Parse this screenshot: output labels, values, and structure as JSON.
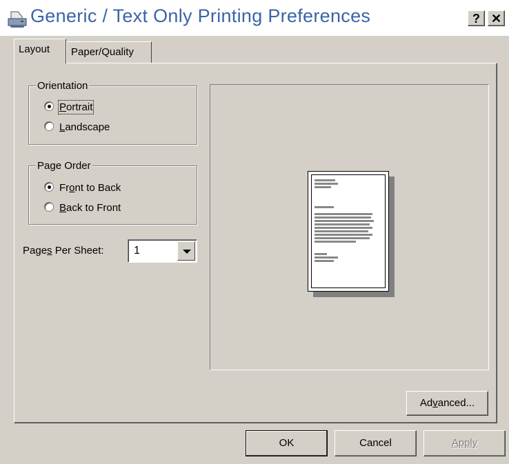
{
  "window": {
    "title": "Generic / Text Only Printing Preferences",
    "icon": "printer-icon",
    "help_label": "?",
    "close_label": "✕"
  },
  "tabs": [
    {
      "label": "Layout",
      "selected": true
    },
    {
      "label": "Paper/Quality",
      "selected": false
    }
  ],
  "orientation": {
    "legend": "Orientation",
    "options": [
      {
        "label_pre": "",
        "label_accel": "P",
        "label_post": "ortrait",
        "checked": true
      },
      {
        "label_pre": "",
        "label_accel": "L",
        "label_post": "andscape",
        "checked": false
      }
    ]
  },
  "page_order": {
    "legend": "Page Order",
    "options": [
      {
        "label_pre": "Fr",
        "label_accel": "o",
        "label_post": "nt to Back",
        "checked": true
      },
      {
        "label_pre": "",
        "label_accel": "B",
        "label_post": "ack to Front",
        "checked": false
      }
    ]
  },
  "pages_per_sheet": {
    "label_pre": "Page",
    "label_accel": "s",
    "label_post": " Per Sheet:",
    "value": "1"
  },
  "buttons": {
    "advanced_pre": "Ad",
    "advanced_accel": "v",
    "advanced_post": "anced...",
    "ok": "OK",
    "cancel": "Cancel",
    "apply": "Apply"
  }
}
